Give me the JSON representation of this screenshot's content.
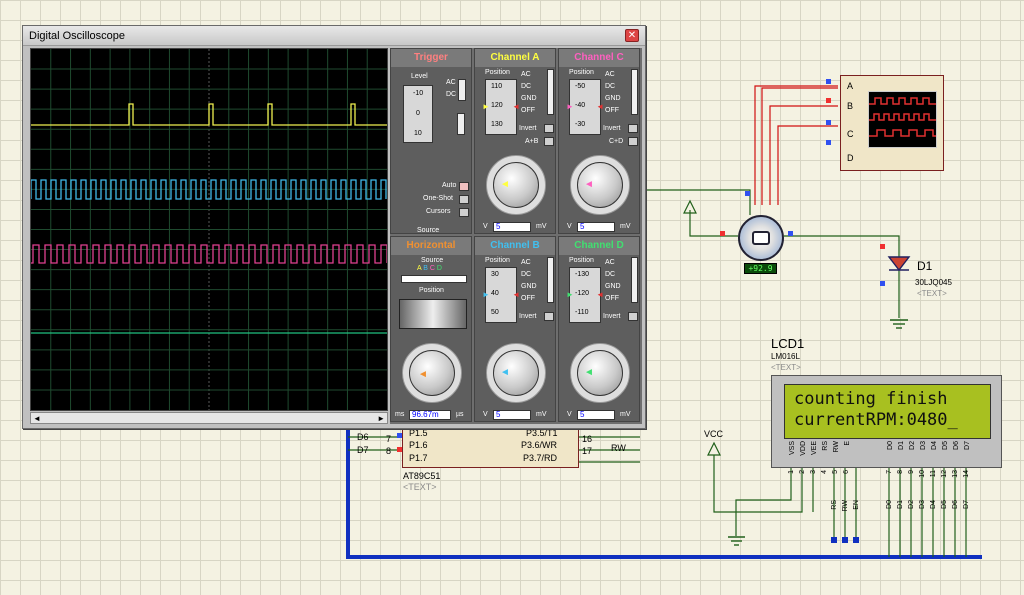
{
  "oscilloscope": {
    "title": "Digital Oscilloscope",
    "trigger": {
      "header": "Trigger",
      "level_label": "Level",
      "level_ticks": [
        "-10",
        "0",
        "10"
      ],
      "coupling": [
        "AC",
        "DC"
      ],
      "mode_buttons": [
        "Auto",
        "One-Shot",
        "Cursors"
      ],
      "source_label": "Source",
      "source_letters": [
        "A",
        "B",
        "C",
        "D"
      ]
    },
    "channel_a": {
      "header": "Channel A",
      "position_label": "Position",
      "ticks": [
        "110",
        "120",
        "130"
      ],
      "coupling": [
        "AC",
        "DC",
        "GND",
        "OFF"
      ],
      "invert": "Invert",
      "combine": "A+B",
      "volts_value": "5",
      "unit_left": "V",
      "unit_right": "mV",
      "dial_marks": [
        "0.2",
        "0.5",
        "1",
        "2",
        "5",
        "10",
        "20",
        "50",
        "0.1",
        "50",
        "20",
        "10",
        "5",
        "2",
        "1"
      ]
    },
    "channel_c": {
      "header": "Channel C",
      "position_label": "Position",
      "ticks": [
        "-50",
        "-40",
        "-30"
      ],
      "coupling": [
        "AC",
        "DC",
        "GND",
        "OFF"
      ],
      "invert": "Invert",
      "combine": "C+D",
      "volts_value": "5",
      "unit_left": "V",
      "unit_right": "mV"
    },
    "horizontal": {
      "header": "Horizontal",
      "source_label": "Source",
      "source_letters": [
        "A",
        "B",
        "C",
        "D"
      ],
      "position_label": "Position",
      "time_value": "96.67m",
      "unit_left": "ms",
      "unit_right": "µs",
      "dial_marks": [
        "0.5",
        "0.2",
        "0.1",
        "50",
        "20",
        "10",
        "5",
        "2",
        "1",
        "0.5",
        "1",
        "2",
        "5",
        "10",
        "20",
        "50"
      ]
    },
    "channel_b": {
      "header": "Channel B",
      "position_label": "Position",
      "ticks": [
        "30",
        "40",
        "50"
      ],
      "coupling": [
        "AC",
        "DC",
        "GND",
        "OFF"
      ],
      "invert": "Invert",
      "volts_value": "5",
      "unit_left": "V",
      "unit_right": "mV"
    },
    "channel_d": {
      "header": "Channel D",
      "position_label": "Position",
      "ticks": [
        "-130",
        "-120",
        "-110"
      ],
      "coupling": [
        "AC",
        "DC",
        "GND",
        "OFF"
      ],
      "invert": "Invert",
      "volts_value": "5",
      "unit_left": "V",
      "unit_right": "mV"
    },
    "colors": {
      "trace_a": "#f0f050",
      "trace_b": "#40b8e8",
      "trace_c": "#e04090",
      "trace_d": "#20c080",
      "trigger": "#ff8080",
      "horizontal": "#f09030",
      "channel_a": "#ffff40",
      "channel_b": "#40c0f0",
      "channel_c": "#ff60c0",
      "channel_d": "#40e070"
    }
  },
  "lcd": {
    "designator": "LCD1",
    "model": "LM016L",
    "text_tag": "<TEXT>",
    "line1": "counting finish",
    "line2": "currentRPM:0480_",
    "pin_names": [
      "VSS",
      "VDD",
      "VEE",
      "RS",
      "RW",
      "E",
      "D0",
      "D1",
      "D2",
      "D3",
      "D4",
      "D5",
      "D6",
      "D7"
    ],
    "pin_numbers": [
      "1",
      "2",
      "3",
      "4",
      "5",
      "6",
      "7",
      "8",
      "9",
      "10",
      "11",
      "12",
      "13",
      "14"
    ],
    "bus_labels": [
      "RS",
      "RW",
      "EN",
      "D0",
      "D1",
      "D2",
      "D3",
      "D4",
      "D5",
      "D6",
      "D7"
    ]
  },
  "mcu": {
    "model": "AT89C51",
    "text_tag": "<TEXT>",
    "left_nets": [
      "D6",
      "D7"
    ],
    "left_pin_numbers": [
      "7",
      "8"
    ],
    "left_pins": [
      "P1.5",
      "P1.6",
      "P1.7"
    ],
    "right_pins": [
      "P3.5/T1",
      "P3.6/WR",
      "P3.7/RD"
    ],
    "right_pin_numbers": [
      "15",
      "16",
      "17"
    ],
    "right_net": "RW"
  },
  "diode": {
    "designator": "D1",
    "model": "30LJQ045",
    "text_tag": "<TEXT>"
  },
  "motor": {
    "readout": "+92.9"
  },
  "scope_icon": {
    "pins": [
      "A",
      "B",
      "C",
      "D"
    ]
  },
  "power": {
    "vcc_label": "VCC"
  }
}
